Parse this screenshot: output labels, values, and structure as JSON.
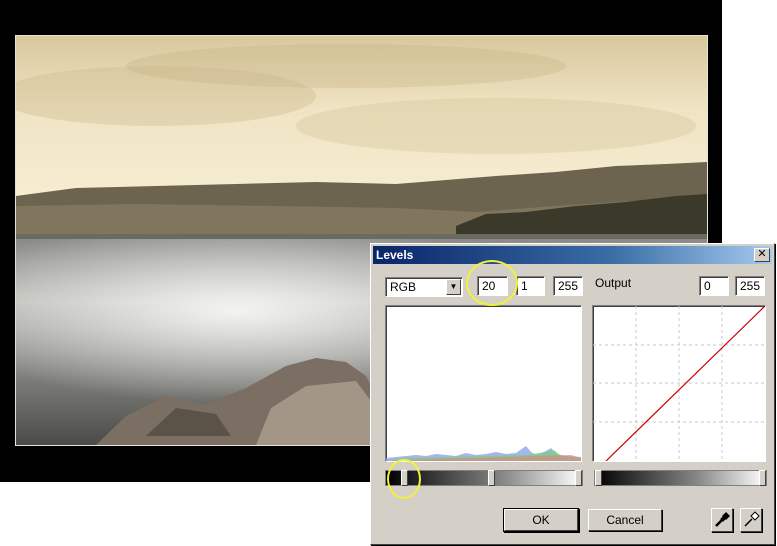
{
  "dialog": {
    "title": "Levels",
    "close_glyph": "✕",
    "channel": {
      "selected": "RGB",
      "arrow": "▼"
    },
    "input": {
      "black": "20",
      "gamma": "1",
      "white": "255"
    },
    "output": {
      "label": "Output",
      "black": "0",
      "white": "255"
    },
    "buttons": {
      "ok": "OK",
      "cancel": "Cancel"
    },
    "icons": [
      "black-point-eyedropper-icon",
      "white-point-eyedropper-icon"
    ]
  },
  "colors": {
    "titlebar_start": "#0a246a",
    "titlebar_end": "#a6caf0",
    "dialog_face": "#d4d0c8",
    "curve_line": "#cc0000",
    "annotation_circle": "#f2f23a"
  },
  "levels": {
    "input_black_fraction": 0.078,
    "input_gamma_fraction": 0.54,
    "input_white_fraction": 1.0,
    "output_black_fraction": 0.0,
    "output_white_fraction": 1.0
  }
}
